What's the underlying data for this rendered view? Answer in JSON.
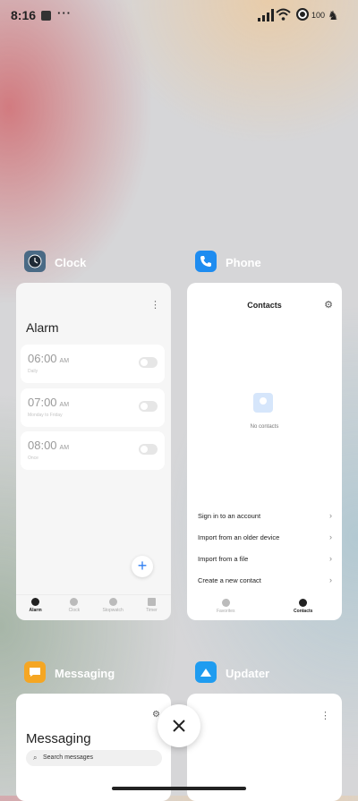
{
  "status_bar": {
    "time": "8:16",
    "dots": "···",
    "battery": "100"
  },
  "apps": {
    "clock": {
      "name": "Clock",
      "icon": "clock-icon",
      "title": "Alarm",
      "alarms": [
        {
          "time": "06:00",
          "ampm": "AM",
          "sub": "Daily"
        },
        {
          "time": "07:00",
          "ampm": "AM",
          "sub": "Monday to Friday"
        },
        {
          "time": "08:00",
          "ampm": "AM",
          "sub": "Once"
        }
      ],
      "nav": [
        "Alarm",
        "Clock",
        "Stopwatch",
        "Timer"
      ]
    },
    "phone": {
      "name": "Phone",
      "icon": "phone-icon",
      "title": "Contacts",
      "empty_text": "No contacts",
      "menu": [
        "Sign in to an account",
        "Import from an older device",
        "Import from a file",
        "Create a new contact"
      ],
      "nav": [
        "Favorites",
        "Contacts"
      ]
    },
    "messaging": {
      "name": "Messaging",
      "icon": "message-icon",
      "title": "Messaging",
      "search_placeholder": "Search messages"
    },
    "updater": {
      "name": "Updater",
      "icon": "updater-icon"
    }
  },
  "colors": {
    "accent": "#2e7ef2",
    "clock_icon_bg": "#4a6a85",
    "phone_icon_bg": "#1e8cf0",
    "messaging_icon_bg": "#f5a623",
    "updater_icon_bg": "#1f9cf0"
  }
}
